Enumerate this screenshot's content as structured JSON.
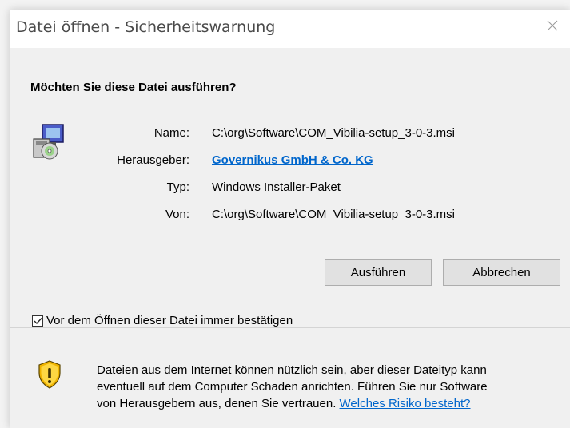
{
  "window": {
    "title": "Datei öffnen - Sicherheitswarnung",
    "close_icon": "close-icon"
  },
  "question": "Möchten Sie diese Datei ausführen?",
  "file_icon": "installer-package-icon",
  "fields": {
    "name_label": "Name:",
    "name_value": "C:\\org\\Software\\COM_Vibilia-setup_3-0-3.msi",
    "publisher_label": "Herausgeber:",
    "publisher_value": "Governikus GmbH & Co. KG",
    "type_label": "Typ:",
    "type_value": "Windows Installer-Paket",
    "from_label": "Von:",
    "from_value": "C:\\org\\Software\\COM_Vibilia-setup_3-0-3.msi"
  },
  "buttons": {
    "run": "Ausführen",
    "cancel": "Abbrechen"
  },
  "checkbox": {
    "label": "Vor dem Öffnen dieser Datei immer bestätigen",
    "checked": true
  },
  "warning": {
    "icon": "shield-warning-icon",
    "line1": "Dateien aus dem Internet können nützlich sein, aber dieser Dateityp kann",
    "line2": "eventuell auf dem Computer Schaden anrichten. Führen Sie nur Software",
    "line3_text": "von Herausgebern aus, denen Sie vertrauen.",
    "link": "Welches Risiko besteht?"
  },
  "colors": {
    "link": "#0066cc",
    "dialog_bg": "#f0f0f0",
    "titlebar_bg": "#ffffff",
    "button_bg": "#e1e1e1"
  }
}
